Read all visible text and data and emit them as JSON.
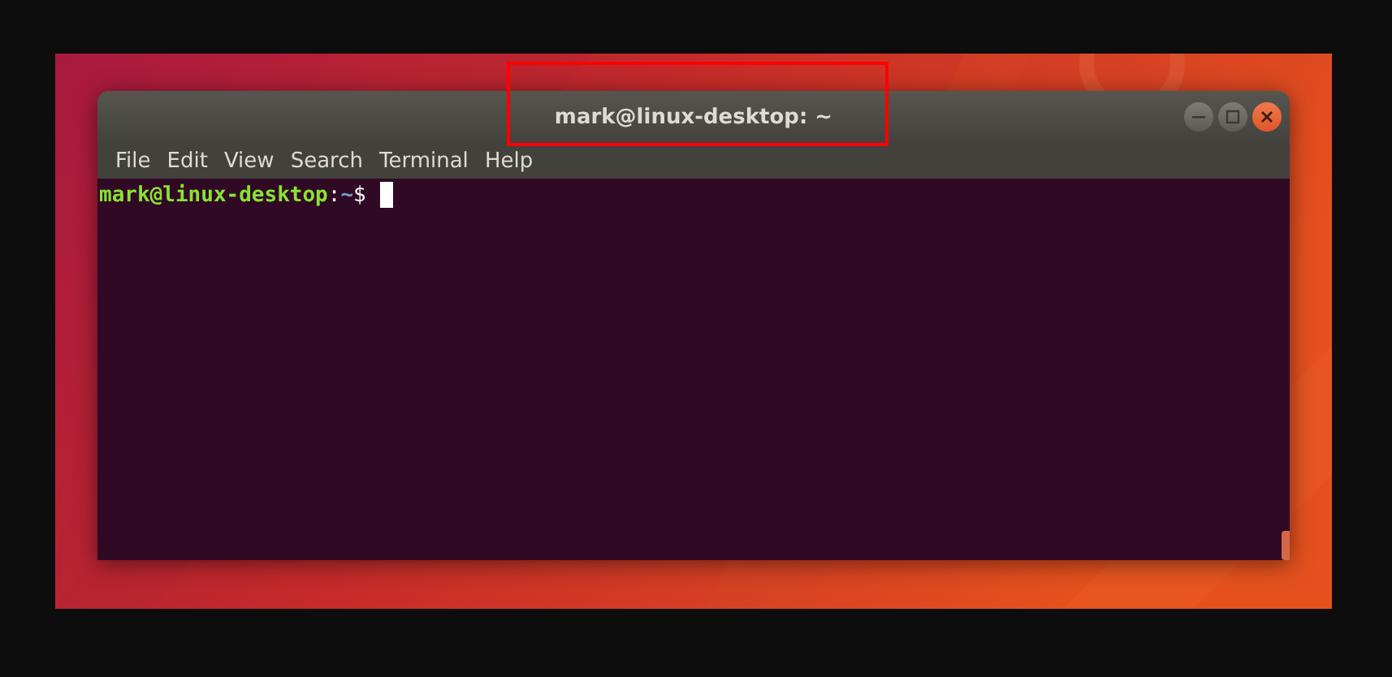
{
  "window": {
    "title": "mark@linux-desktop: ~",
    "highlighted": true
  },
  "menu": [
    {
      "label": "File"
    },
    {
      "label": "Edit"
    },
    {
      "label": "View"
    },
    {
      "label": "Search"
    },
    {
      "label": "Terminal"
    },
    {
      "label": "Help"
    }
  ],
  "terminal": {
    "prompt": {
      "user_host": "mark@linux-desktop",
      "separator": ":",
      "path": "~",
      "symbol": "$"
    }
  }
}
